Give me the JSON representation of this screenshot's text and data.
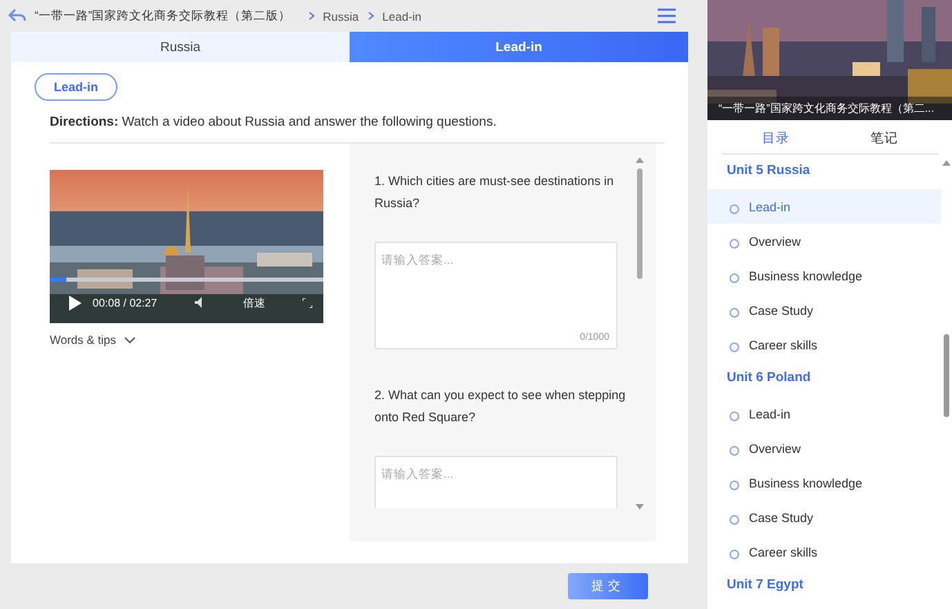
{
  "header": {
    "book_title": "“一带一路”国家跨文化商务交际教程（第二版）",
    "breadcrumb": [
      "Russia",
      "Lead-in"
    ]
  },
  "tabs": [
    {
      "label": "Russia",
      "selected": false
    },
    {
      "label": "Lead-in",
      "selected": true
    }
  ],
  "section_badge": "Lead-in",
  "directions": {
    "label": "Directions:",
    "text": "Watch a video about Russia and answer the following questions."
  },
  "video": {
    "time": "00:08 / 02:27",
    "speed": "倍速",
    "level": 0.06
  },
  "words_tips": "Words & tips",
  "questions": [
    {
      "text": "1. Which cities are must-see destinations in Russia?",
      "placeholder": "请输入答案...",
      "counter": "0/1000"
    },
    {
      "text": "2. What can you expect to see when stepping onto Red Square?",
      "placeholder": "请输入答案..."
    }
  ],
  "submit": "提交",
  "sidebar": {
    "caption": "“一带一路”国家跨文化商务交际教程（第二...",
    "tabs": [
      {
        "label": "目录",
        "selected": true
      },
      {
        "label": "笔记",
        "selected": false
      }
    ],
    "units": [
      {
        "title": "Unit 5 Russia",
        "children": [
          {
            "label": "Lead-in",
            "selected": true
          },
          {
            "label": "Overview",
            "selected": false
          },
          {
            "label": "Business knowledge",
            "selected": false
          },
          {
            "label": "Case Study",
            "selected": false
          },
          {
            "label": "Career skills",
            "selected": false
          }
        ]
      },
      {
        "title": "Unit 6 Poland",
        "children": [
          {
            "label": "Lead-in",
            "selected": false
          },
          {
            "label": "Overview",
            "selected": false
          },
          {
            "label": "Business knowledge",
            "selected": false
          },
          {
            "label": "Case Study",
            "selected": false
          },
          {
            "label": "Career skills",
            "selected": false
          }
        ]
      },
      {
        "title": "Unit 7 Egypt"
      }
    ]
  }
}
